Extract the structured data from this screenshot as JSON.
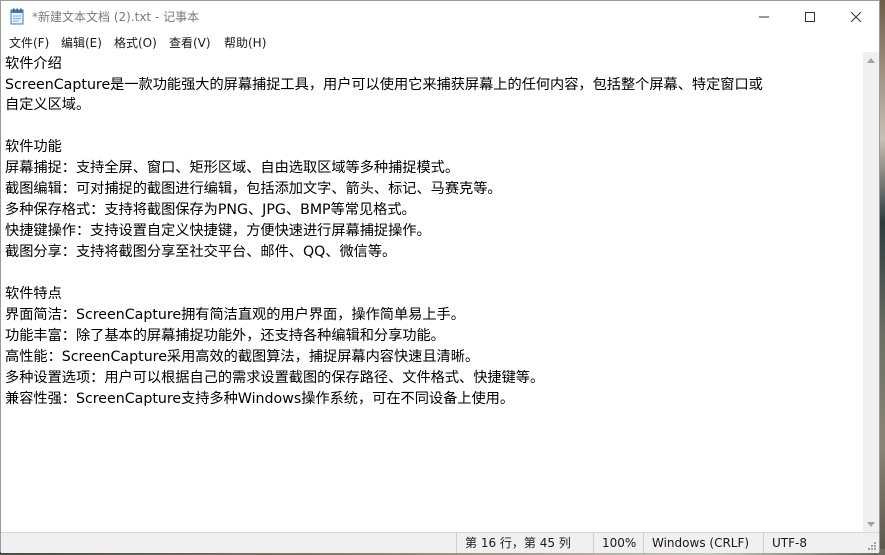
{
  "window": {
    "title": "*新建文本文档 (2).txt - 记事本"
  },
  "menu": [
    {
      "label": "文件(F)"
    },
    {
      "label": "编辑(E)"
    },
    {
      "label": "格式(O)"
    },
    {
      "label": "查看(V)"
    },
    {
      "label": "帮助(H)"
    }
  ],
  "document": {
    "lines": [
      "软件介绍",
      "ScreenCapture是一款功能强大的屏幕捕捉工具，用户可以使用它来捕获屏幕上的任何内容，包括整个屏幕、特定窗口或",
      "自定义区域。",
      "",
      "软件功能",
      "屏幕捕捉：支持全屏、窗口、矩形区域、自由选取区域等多种捕捉模式。",
      "截图编辑：可对捕捉的截图进行编辑，包括添加文字、箭头、标记、马赛克等。",
      "多种保存格式：支持将截图保存为PNG、JPG、BMP等常见格式。",
      "快捷键操作：支持设置自定义快捷键，方便快速进行屏幕捕捉操作。",
      "截图分享：支持将截图分享至社交平台、邮件、QQ、微信等。",
      "",
      "软件特点",
      "界面简洁：ScreenCapture拥有简洁直观的用户界面，操作简单易上手。",
      "功能丰富：除了基本的屏幕捕捉功能外，还支持各种编辑和分享功能。",
      "高性能：ScreenCapture采用高效的截图算法，捕捉屏幕内容快速且清晰。",
      "多种设置选项：用户可以根据自己的需求设置截图的保存路径、文件格式、快捷键等。",
      "兼容性强：ScreenCapture支持多种Windows操作系统，可在不同设备上使用。"
    ]
  },
  "status": {
    "position": "第 16 行，第 45 列",
    "zoom": "100%",
    "line_ending": "Windows (CRLF)",
    "encoding": "UTF-8"
  },
  "icons": {
    "app": "notepad-icon",
    "minimize": "minimize-icon",
    "maximize": "maximize-icon",
    "close": "close-icon"
  }
}
